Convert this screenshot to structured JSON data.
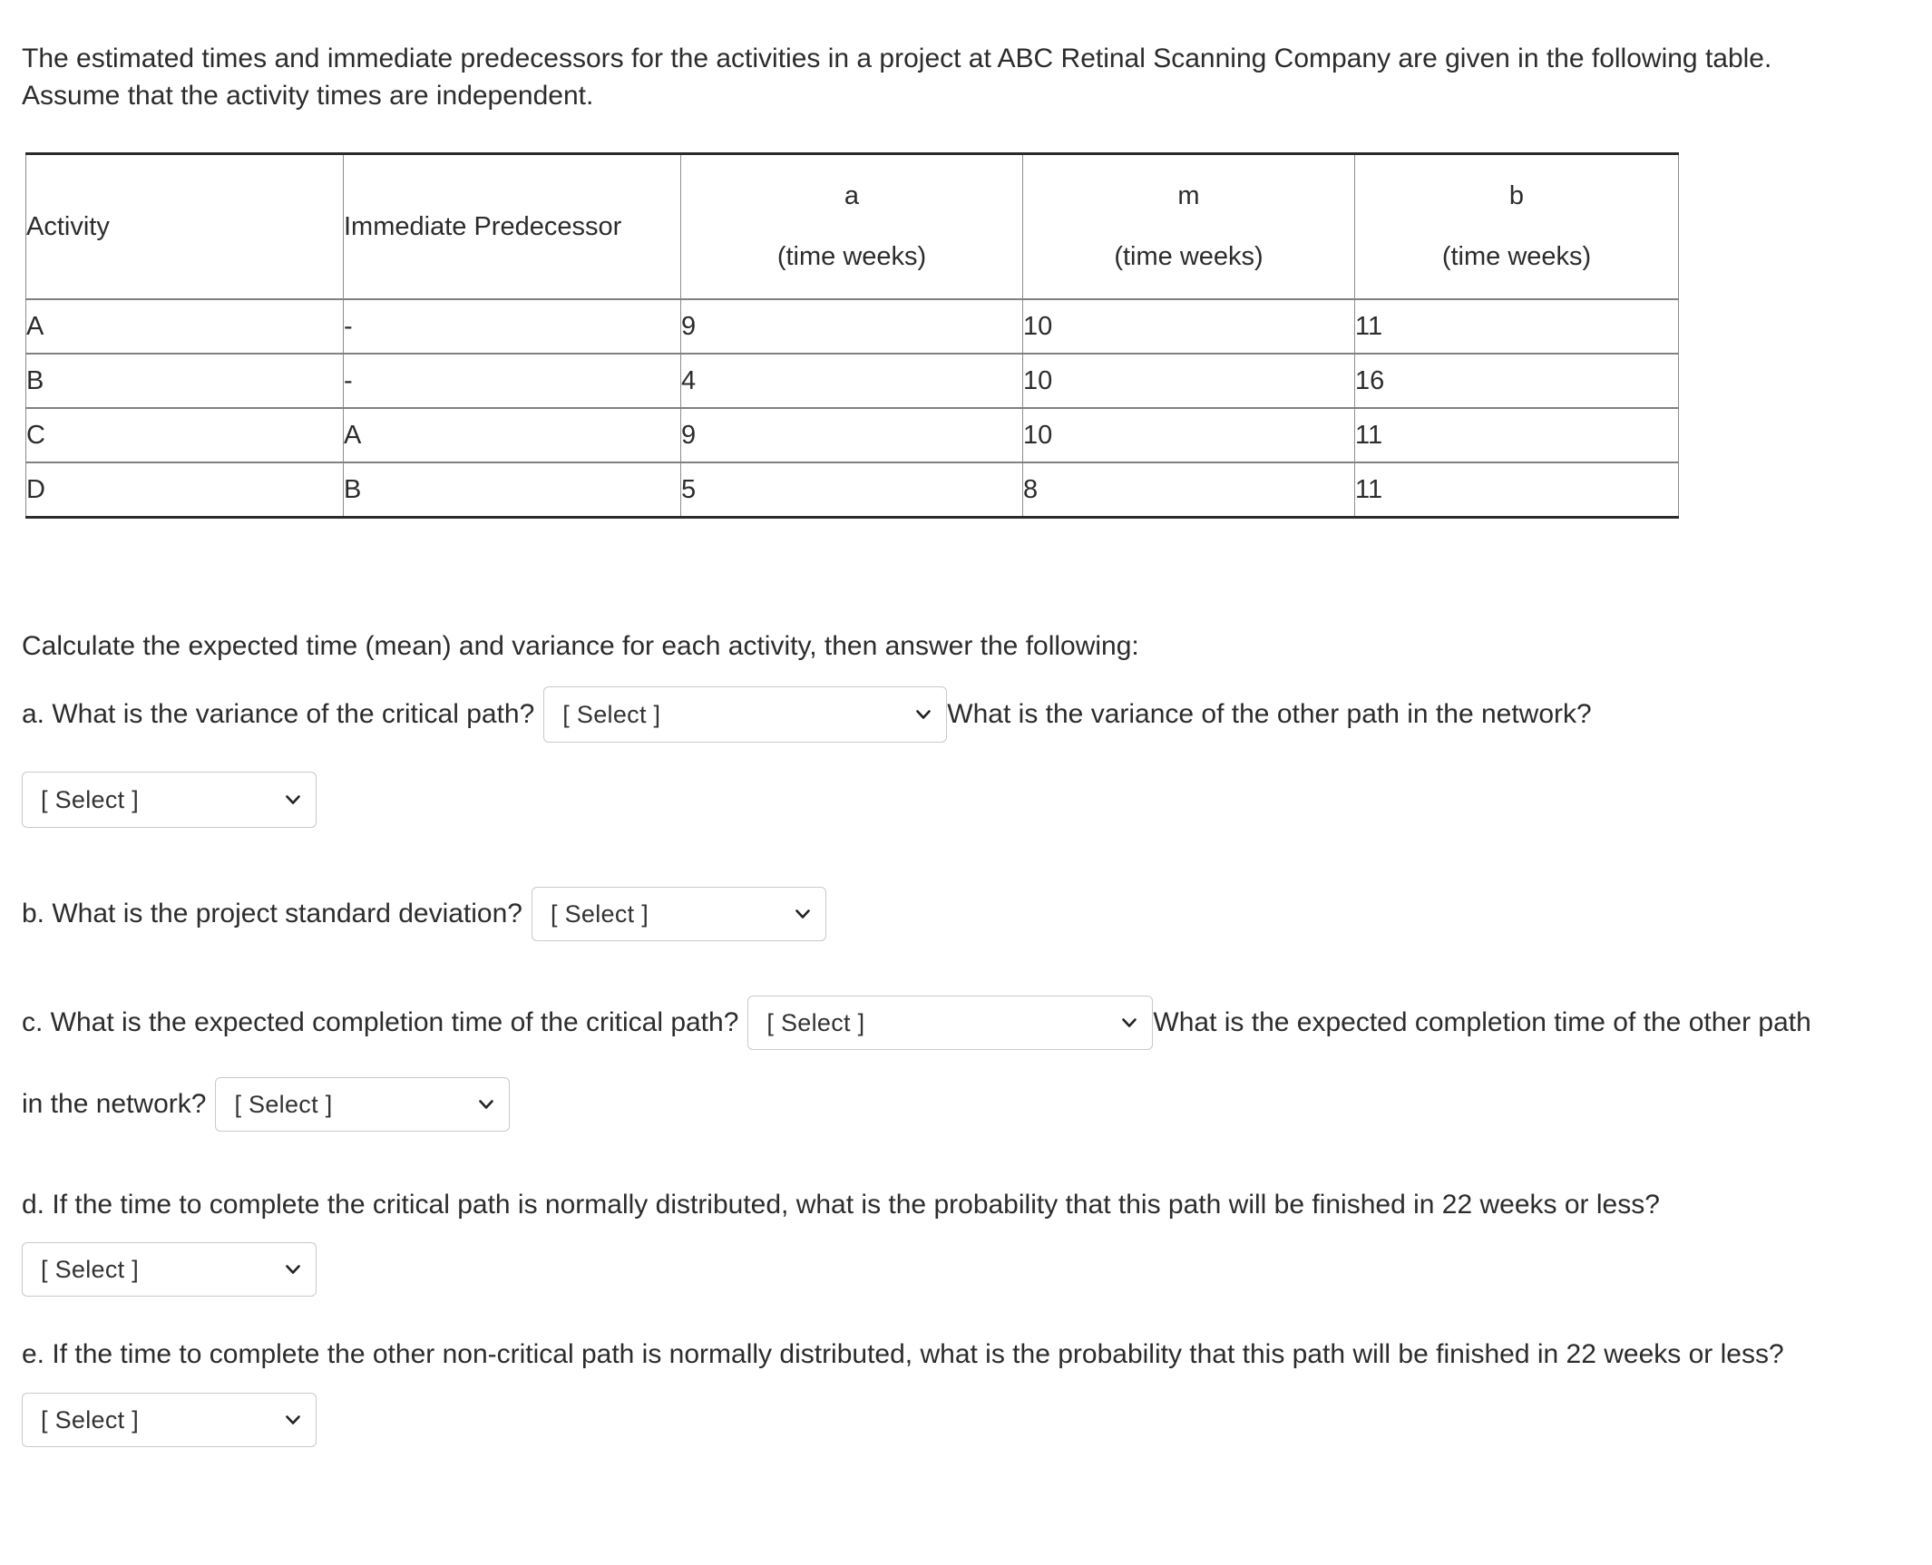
{
  "intro": {
    "line1": "The estimated times and immediate predecessors for the activities in a project at ABC Retinal Scanning Company are given in the following table.",
    "line2": "Assume that the activity times are independent."
  },
  "table": {
    "headers": {
      "activity": "Activity",
      "predecessor": "Immediate Predecessor",
      "a_symbol": "a",
      "a_unit": "(time weeks)",
      "m_symbol": "m",
      "m_unit": "(time weeks)",
      "b_symbol": "b",
      "b_unit": "(time weeks)"
    },
    "rows": [
      {
        "activity": "A",
        "predecessor": "-",
        "a": "9",
        "m": "10",
        "b": "11"
      },
      {
        "activity": "B",
        "predecessor": "-",
        "a": "4",
        "m": "10",
        "b": "16"
      },
      {
        "activity": "C",
        "predecessor": "A",
        "a": "9",
        "m": "10",
        "b": "11"
      },
      {
        "activity": "D",
        "predecessor": "B",
        "a": "5",
        "m": "8",
        "b": "11"
      }
    ]
  },
  "instruction": "Calculate the expected time (mean) and variance for each activity, then answer the following:",
  "questions": {
    "a": {
      "prompt": "a. What is the variance of the critical path?",
      "select1": "[ Select ]",
      "mid": "What is the variance of the other path in the network?",
      "select2": "[ Select ]"
    },
    "b": {
      "prompt": "b. What is the project standard deviation?",
      "select1": "[ Select ]"
    },
    "c": {
      "prompt": "c. What is the expected completion time of the critical path?",
      "select1": "[ Select ]",
      "mid": "What is the expected completion time of the other path",
      "prompt2": "in the network?",
      "select2": "[ Select ]"
    },
    "d": {
      "prompt": "d. If the time to complete the critical path is normally distributed, what is the probability that this path will be finished in 22 weeks or less?",
      "select1": "[ Select ]"
    },
    "e": {
      "prompt": "e. If the time to complete the other non-critical path is normally distributed, what is the probability that this path will be finished in 22 weeks or less?",
      "select1": "[ Select ]"
    }
  },
  "icons": {
    "chevron": "chevron-down-icon"
  },
  "colors": {
    "text": "#2c2c2c",
    "table_border_outer": "#2b2b2b",
    "table_border_inner": "#808080",
    "select_border": "#c9c9c9",
    "background": "#ffffff"
  }
}
